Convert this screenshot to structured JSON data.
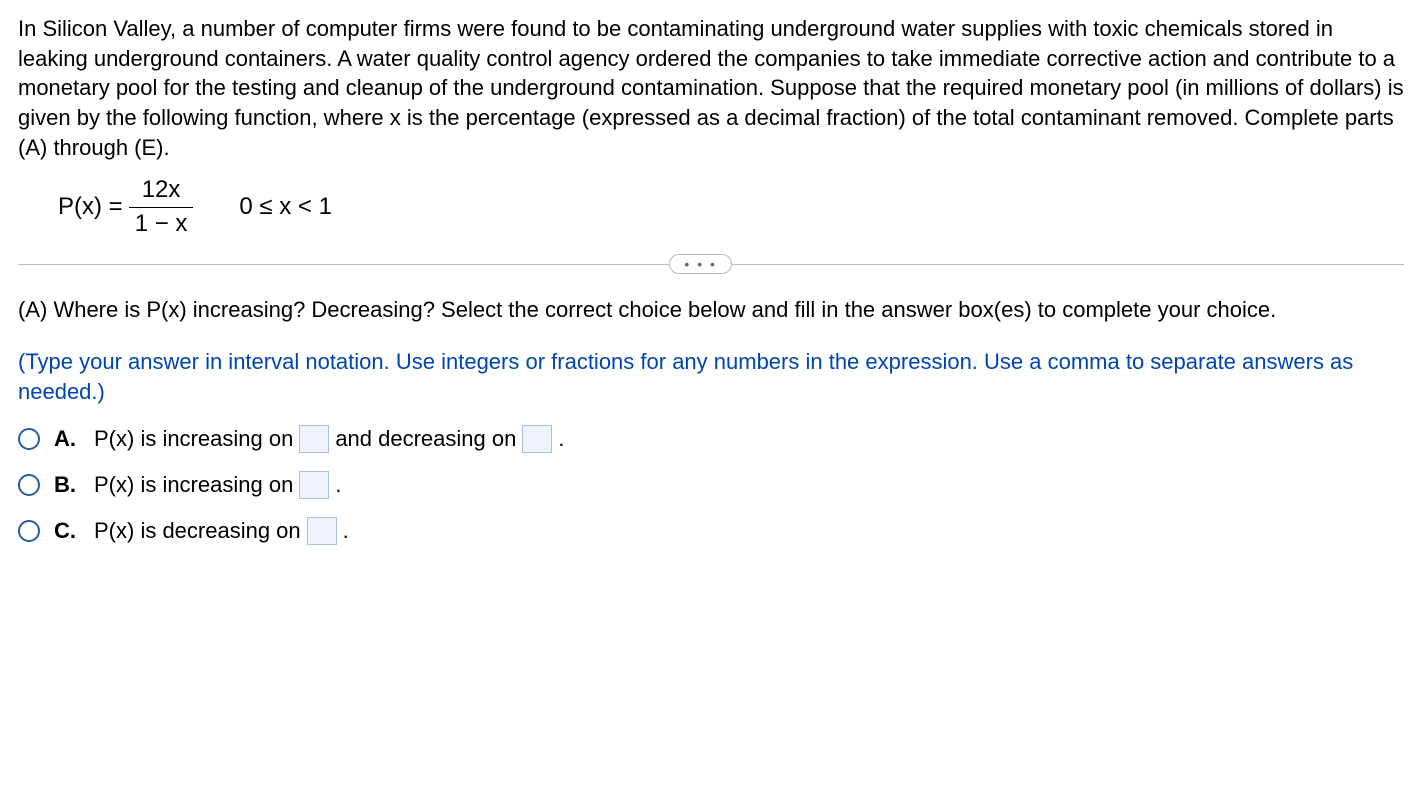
{
  "problem": {
    "statement": "In Silicon Valley, a number of computer firms were found to be contaminating underground water supplies with toxic chemicals stored in leaking underground containers. A water quality control agency ordered the companies to take immediate corrective action and contribute to a monetary pool for the testing and cleanup of the underground contamination. Suppose that the required monetary pool (in millions of dollars) is given by the following function, where x is the percentage (expressed as a decimal fraction) of the total contaminant removed. Complete parts (A) through (E)."
  },
  "formula": {
    "lhs": "P(x) =",
    "numerator": "12x",
    "denominator": "1 − x",
    "domain": "0 ≤ x < 1"
  },
  "divider": {
    "dots": "• • •"
  },
  "partA": {
    "prompt": "(A) Where is P(x) increasing? Decreasing? Select the correct choice below and fill in the answer box(es) to complete your choice.",
    "hint": "(Type your answer in interval notation. Use integers or fractions for any  numbers in the expression. Use a comma to separate answers as needed.)"
  },
  "choices": {
    "A": {
      "letter": "A.",
      "seg1": "P(x) is increasing on ",
      "seg2": " and decreasing on ",
      "seg3": "."
    },
    "B": {
      "letter": "B.",
      "seg1": "P(x) is increasing on ",
      "seg2": "."
    },
    "C": {
      "letter": "C.",
      "seg1": "P(x) is decreasing on ",
      "seg2": "."
    }
  }
}
